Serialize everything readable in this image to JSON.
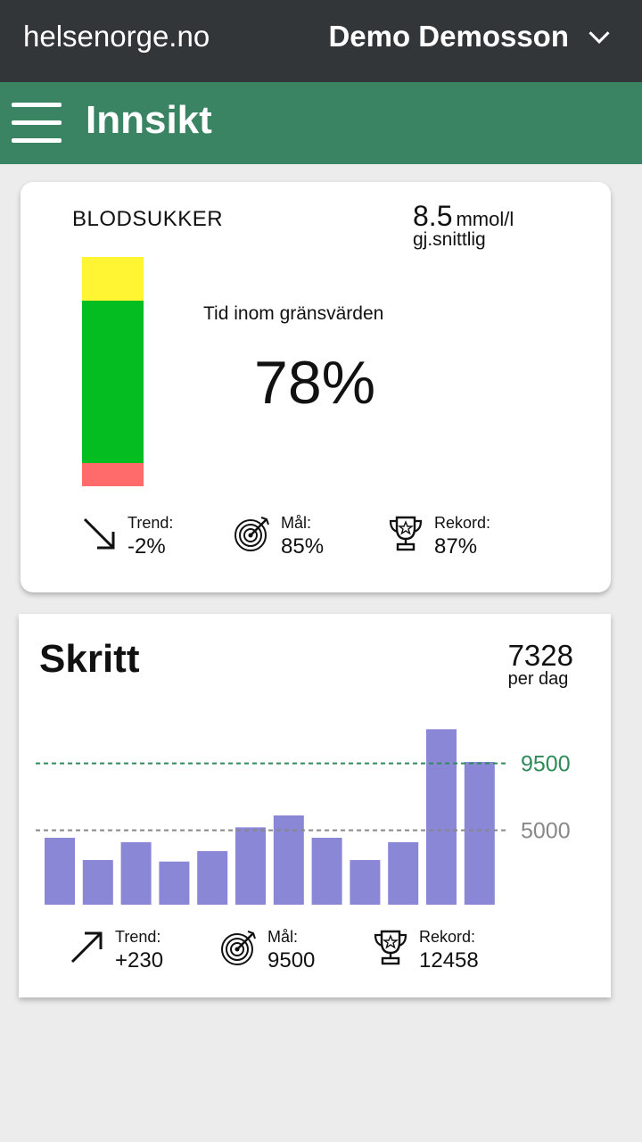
{
  "header": {
    "brand": "helsenorge.no",
    "user_name": "Demo Demosson"
  },
  "subheader": {
    "title": "Innsikt"
  },
  "blood_sugar": {
    "title": "BLODSUKKER",
    "avg_value": "8.5",
    "avg_unit": "mmol/l",
    "avg_caption": "gj.snittlig",
    "range_fractions": {
      "high": 0.19,
      "in_range": 0.71,
      "low": 0.1
    },
    "colors": {
      "high": "#fff533",
      "in_range": "#03bd21",
      "low": "#ff6b6b"
    },
    "tir_label": "Tid inom gränsvärden",
    "tir_value": "78%",
    "stats": [
      {
        "icon": "arrow-down-right-icon",
        "label": "Trend:",
        "value": "-2%"
      },
      {
        "icon": "target-icon",
        "label": "Mål:",
        "value": "85%"
      },
      {
        "icon": "trophy-icon",
        "label": "Rekord:",
        "value": "87%"
      }
    ]
  },
  "steps": {
    "title": "Skritt",
    "avg_value": "7328",
    "avg_caption": "per dag",
    "stats": [
      {
        "icon": "arrow-up-right-icon",
        "label": "Trend:",
        "value": "+230"
      },
      {
        "icon": "target-icon",
        "label": "Mål:",
        "value": "9500"
      },
      {
        "icon": "trophy-icon",
        "label": "Rekord:",
        "value": "12458"
      }
    ]
  },
  "chart_data": {
    "type": "bar",
    "values": [
      4500,
      3000,
      4200,
      2900,
      3600,
      5200,
      6000,
      4500,
      3000,
      4200,
      11800,
      9600
    ],
    "ylim": [
      0,
      12000
    ],
    "reference_lines": [
      {
        "value": 9500,
        "label": "9500",
        "color": "#2e8b57"
      },
      {
        "value": 5000,
        "label": "5000",
        "color": "#888888"
      }
    ],
    "bar_color": "#8a87d6",
    "grid": false
  }
}
